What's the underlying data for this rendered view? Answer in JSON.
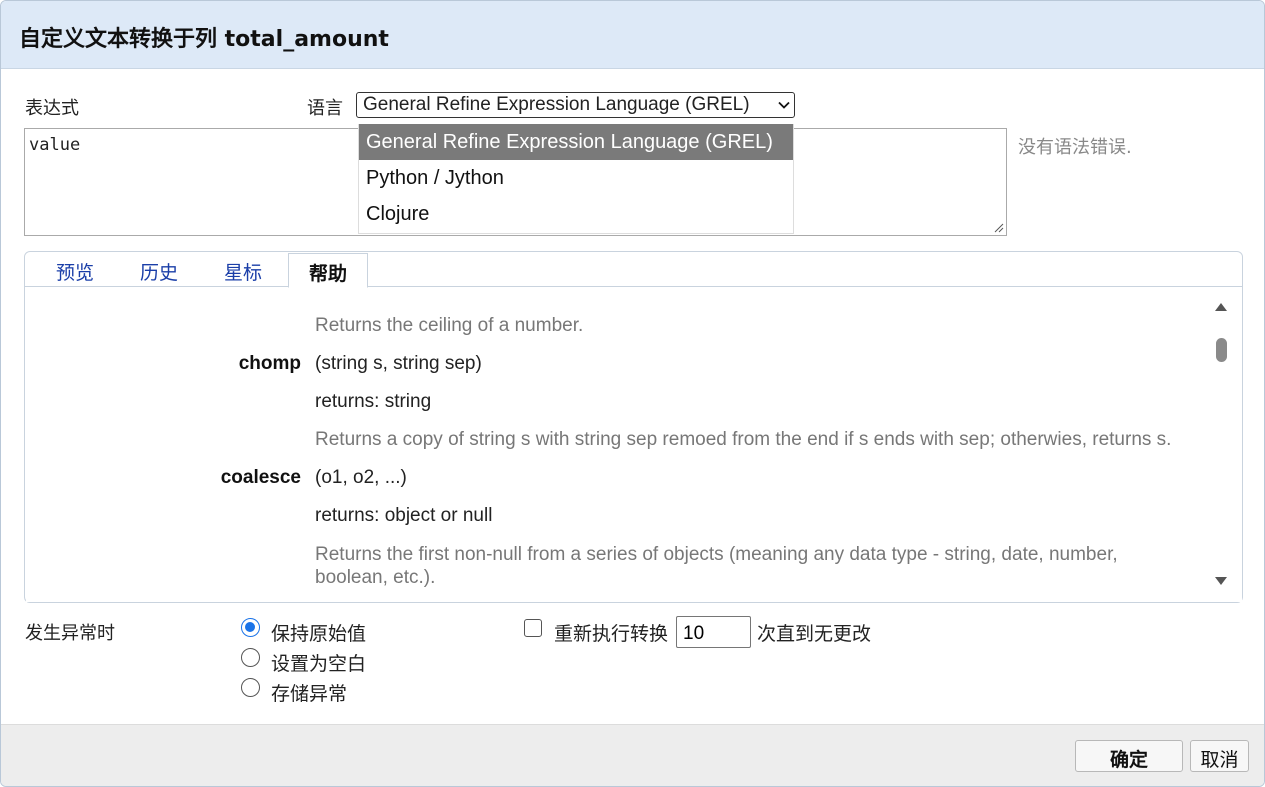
{
  "dialog": {
    "title": "自定义文本转换于列 total_amount"
  },
  "expression": {
    "label": "表达式",
    "value": "value",
    "status": "没有语法错误."
  },
  "language": {
    "label": "语言",
    "selected": "General Refine Expression Language (GREL)",
    "options": [
      "General Refine Expression Language (GREL)",
      "Python / Jython",
      "Clojure"
    ],
    "highlighted_index": 0
  },
  "tabs": [
    {
      "label": "预览",
      "active": false
    },
    {
      "label": "历史",
      "active": false
    },
    {
      "label": "星标",
      "active": false
    },
    {
      "label": "帮助",
      "active": true
    }
  ],
  "help": {
    "entries": [
      {
        "name": "",
        "lines": [
          {
            "text": "Returns the ceiling of a number.",
            "kind": "desc"
          }
        ]
      },
      {
        "name": "chomp",
        "lines": [
          {
            "text": "(string s, string sep)",
            "kind": "sig"
          },
          {
            "text": "returns: string",
            "kind": "ret"
          },
          {
            "text": "Returns a copy of string s with string sep remoed from the end if s ends with sep; otherwies, returns s.",
            "kind": "desc"
          }
        ]
      },
      {
        "name": "coalesce",
        "lines": [
          {
            "text": "(o1, o2, ...)",
            "kind": "sig"
          },
          {
            "text": "returns: object or null",
            "kind": "ret"
          },
          {
            "text": "Returns the first non-null from a series of objects (meaning any data type - string, date, number, boolean, etc.).",
            "kind": "desc"
          }
        ]
      }
    ]
  },
  "on_error": {
    "label": "发生异常时",
    "options": [
      {
        "label": "保持原始值",
        "checked": true
      },
      {
        "label": "设置为空白",
        "checked": false
      },
      {
        "label": "存储异常",
        "checked": false
      }
    ]
  },
  "repeat": {
    "checked": false,
    "label": "重新执行转换",
    "count": "10",
    "suffix": "次直到无更改"
  },
  "footer": {
    "ok_label": "确定",
    "cancel_label": "取消"
  },
  "colors": {
    "titlebar_bg": "#dde9f7",
    "link_tab": "#1a3ea8",
    "radio_accent": "#1a73e8",
    "dropdown_highlight": "#7a7a7a"
  },
  "icons": [
    "chevron-down-icon",
    "resize-grip-icon",
    "scroll-up-arrow-icon",
    "scroll-down-arrow-icon"
  ]
}
